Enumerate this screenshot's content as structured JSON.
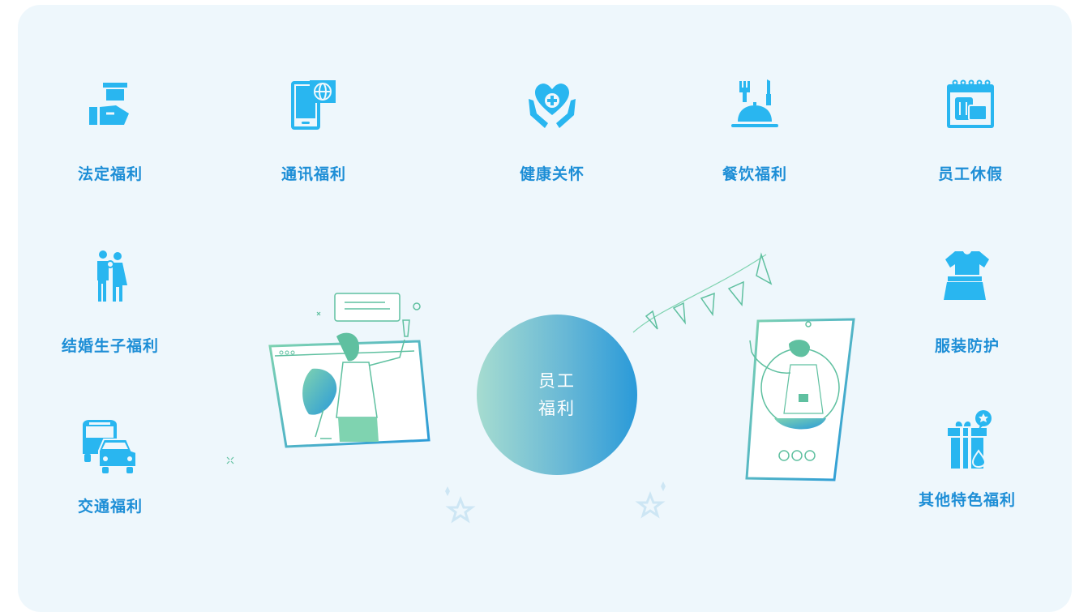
{
  "center": {
    "line1": "员工",
    "line2": "福利"
  },
  "benefits": [
    {
      "label": "法定福利",
      "icon": "gift-hand-icon"
    },
    {
      "label": "通讯福利",
      "icon": "phone-globe-icon"
    },
    {
      "label": "健康关怀",
      "icon": "heart-hands-icon"
    },
    {
      "label": "餐饮福利",
      "icon": "dining-cloche-icon"
    },
    {
      "label": "员工休假",
      "icon": "calendar-luggage-icon"
    },
    {
      "label": "结婚生子福利",
      "icon": "couple-icon"
    },
    {
      "label": "服装防护",
      "icon": "clothing-icon"
    },
    {
      "label": "交通福利",
      "icon": "bus-car-icon"
    },
    {
      "label": "其他特色福利",
      "icon": "gift-box-icon"
    }
  ],
  "colors": {
    "accent": "#1d8ed6",
    "icon": "#29b6f0",
    "panel": "#eef7fc",
    "illustration": "#5fc0a0"
  }
}
